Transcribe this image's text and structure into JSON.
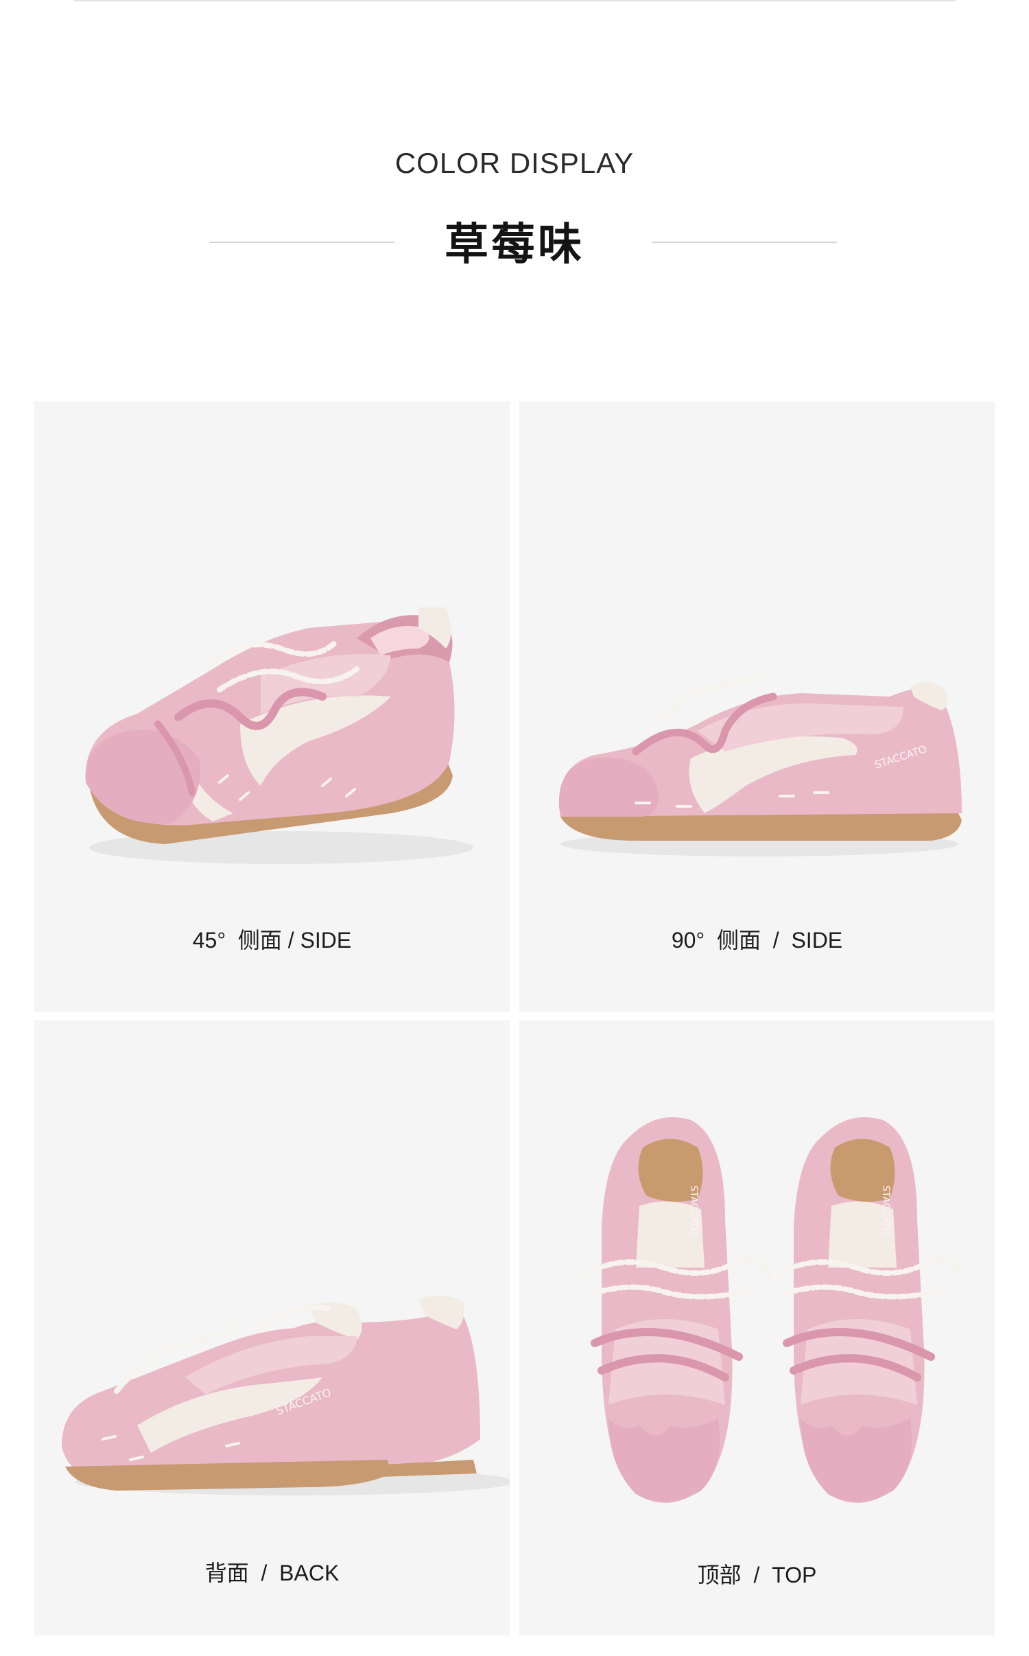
{
  "header": {
    "title_en": "COLOR DISPLAY",
    "title_cn": "草莓味"
  },
  "colors": {
    "panel_bg": "#f5f5f5",
    "shoe_pink": "#e9b9c8",
    "shoe_pink_dark": "#d99aae",
    "shoe_cream": "#f3ece4",
    "sole": "#c79a72"
  },
  "views": [
    {
      "caption": "45°  侧面 / SIDE",
      "icon": "shoe-45-side"
    },
    {
      "caption": "90°  侧面  /  SIDE",
      "icon": "shoe-90-side"
    },
    {
      "caption": "背面  /  BACK",
      "icon": "shoe-back"
    },
    {
      "caption": "顶部  /  TOP",
      "icon": "shoe-top"
    }
  ]
}
